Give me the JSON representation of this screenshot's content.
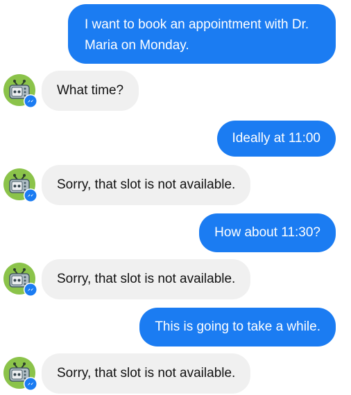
{
  "conversation": {
    "messages": [
      {
        "sender": "user",
        "text": "I want to book an appointment with Dr. Maria on Monday."
      },
      {
        "sender": "bot",
        "text": "What time?"
      },
      {
        "sender": "user",
        "text": "Ideally at 11:00"
      },
      {
        "sender": "bot",
        "text": "Sorry, that slot is not available."
      },
      {
        "sender": "user",
        "text": "How about 11:30?"
      },
      {
        "sender": "bot",
        "text": "Sorry, that slot is not available."
      },
      {
        "sender": "user",
        "text": "This is going to take a while."
      },
      {
        "sender": "bot",
        "text": "Sorry, that slot is not available."
      }
    ]
  },
  "colors": {
    "user_bubble": "#1b7cf2",
    "bot_bubble": "#f0f0f0",
    "messenger_badge": "#1b7cf2",
    "avatar_background": "#8bc34a"
  },
  "icons": {
    "bot_avatar": "robot-icon",
    "badge": "messenger-icon"
  }
}
